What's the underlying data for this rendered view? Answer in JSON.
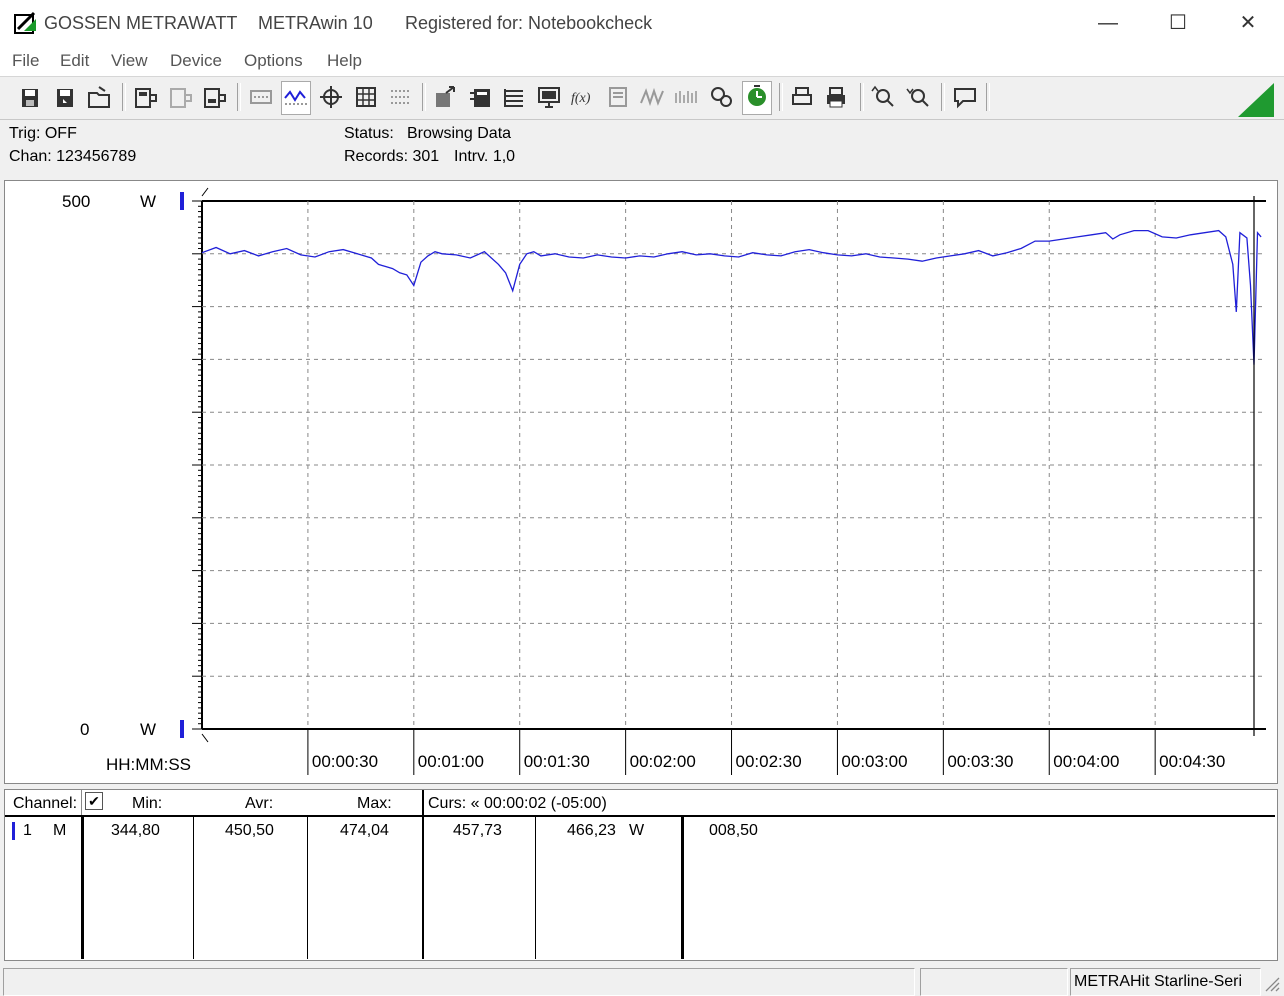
{
  "title": {
    "brand": "GOSSEN METRAWATT",
    "app": "METRAwin 10",
    "registered": "Registered for: Notebookcheck"
  },
  "window_controls": {
    "minimize": "—",
    "maximize": "☐",
    "close": "✕"
  },
  "menu": [
    "File",
    "Edit",
    "View",
    "Device",
    "Options",
    "Help"
  ],
  "toolbar_icons": [
    "save-icon",
    "save-as-icon",
    "open-folder-icon",
    "device-read-icon",
    "device-disabled-icon",
    "device-send-icon",
    "numeric-view-icon",
    "line-chart-icon",
    "crosshair-icon",
    "table-icon",
    "dotted-grid-icon",
    "export-icon",
    "import-icon",
    "settings-list-icon",
    "monitor-icon",
    "function-icon",
    "memory-icon",
    "waveform-icon",
    "waveform-disabled-icon",
    "search-icon",
    "timer-icon",
    "print-preview-icon",
    "print-icon",
    "zoom-in-icon",
    "zoom-out-icon",
    "comment-icon"
  ],
  "info": {
    "trig": "Trig: OFF",
    "chan": "Chan:  123456789",
    "status_label": "Status:",
    "status_value": "Browsing Data",
    "records": "Records: 301",
    "interval": "Intrv. 1,0"
  },
  "chart_data": {
    "type": "line",
    "ymax_label": "500",
    "ymin_label": "0",
    "yunit": "W",
    "xlabel": "HH:MM:SS",
    "ylim": [
      0,
      500
    ],
    "xlim_seconds": [
      0,
      300
    ],
    "x_ticks": [
      "00:00:30",
      "00:01:00",
      "00:01:30",
      "00:02:00",
      "00:02:30",
      "00:03:00",
      "00:03:30",
      "00:04:00",
      "00:04:30"
    ],
    "series": [
      {
        "color": "#2020d8",
        "x": [
          0,
          4,
          8,
          12,
          16,
          20,
          24,
          28,
          32,
          36,
          40,
          44,
          48,
          50,
          52,
          54,
          56,
          58,
          60,
          62,
          64,
          66,
          68,
          72,
          76,
          80,
          84,
          86,
          88,
          90,
          92,
          94,
          96,
          100,
          104,
          108,
          112,
          116,
          120,
          124,
          128,
          132,
          136,
          140,
          144,
          148,
          152,
          156,
          160,
          164,
          168,
          172,
          176,
          180,
          184,
          188,
          192,
          196,
          200,
          204,
          208,
          212,
          216,
          220,
          224,
          228,
          232,
          236,
          240,
          244,
          248,
          252,
          256,
          258,
          260,
          264,
          268,
          272,
          276,
          280,
          284,
          288,
          290,
          292,
          293,
          294,
          296,
          297,
          298,
          299,
          300
        ],
        "y": [
          451,
          456,
          450,
          453,
          448,
          452,
          455,
          449,
          447,
          452,
          454,
          450,
          446,
          440,
          438,
          436,
          432,
          430,
          420,
          442,
          448,
          452,
          450,
          449,
          446,
          452,
          440,
          432,
          415,
          440,
          450,
          452,
          448,
          450,
          447,
          446,
          449,
          447,
          446,
          448,
          447,
          450,
          452,
          449,
          450,
          448,
          447,
          451,
          449,
          448,
          452,
          454,
          451,
          449,
          448,
          450,
          447,
          446,
          445,
          443,
          446,
          448,
          450,
          453,
          448,
          451,
          455,
          462,
          462,
          464,
          466,
          468,
          470,
          464,
          468,
          472,
          472,
          466,
          465,
          468,
          470,
          472,
          466,
          440,
          395,
          470,
          465,
          420,
          345,
          470,
          466
        ]
      }
    ]
  },
  "table": {
    "headers": {
      "channel": "Channel:",
      "check": "✔",
      "min": "Min:",
      "avr": "Avr:",
      "max": "Max:",
      "curs": "Curs: « 00:00:02 (-05:00)"
    },
    "row": {
      "num": "1",
      "mode": "M",
      "min": "344,80",
      "avr": "450,50",
      "max": "474,04",
      "curs1": "457,73",
      "curs2": "466,23",
      "unit": "W",
      "diff": "008,50"
    }
  },
  "statusbar": {
    "device": "METRAHit Starline-Seri"
  }
}
